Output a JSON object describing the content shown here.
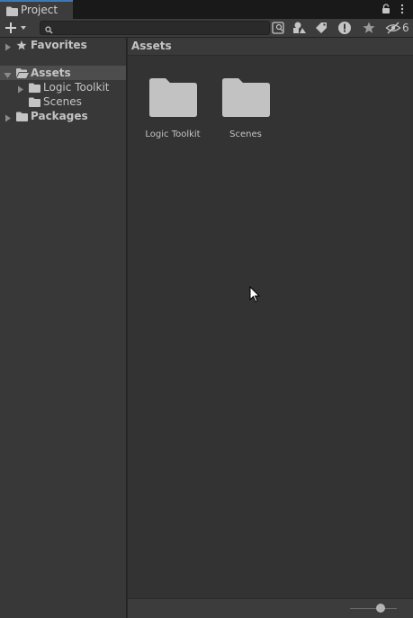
{
  "tab": {
    "title": "Project",
    "icon": "folder-icon"
  },
  "tab_actions": {
    "lock_icon": "lock-icon",
    "menu_icon": "kebab-menu-icon"
  },
  "toolbar": {
    "create_icon": "plus-dropdown-icon",
    "search": {
      "value": "",
      "placeholder": ""
    },
    "hidden_count": "6",
    "buttons": [
      "search-by-type-icon",
      "search-by-label-icon",
      "search-by-log-icon",
      "favorite-icon",
      "hidden-packages-icon"
    ]
  },
  "sidebar": {
    "favorites": "Favorites",
    "assets": "Assets",
    "logic_toolkit": "Logic Toolkit",
    "scenes": "Scenes",
    "packages": "Packages"
  },
  "main": {
    "breadcrumb": "Assets",
    "items": [
      {
        "label": "Logic Toolkit",
        "icon": "folder-icon"
      },
      {
        "label": "Scenes",
        "icon": "folder-icon"
      }
    ],
    "zoom": 0.7
  },
  "colors": {
    "accent": "#3a79bb",
    "panel": "#383838",
    "main": "#333333",
    "selected": "#4d4d4d"
  }
}
